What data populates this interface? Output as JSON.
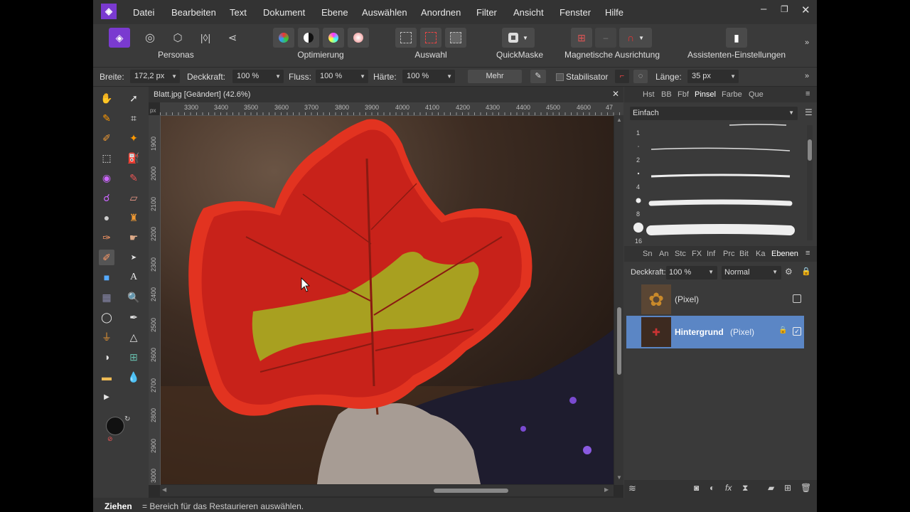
{
  "menu": [
    "Datei",
    "Bearbeiten",
    "Text",
    "Dokument",
    "Ebene",
    "Auswählen",
    "Anordnen",
    "Filter",
    "Ansicht",
    "Fenster",
    "Hilfe"
  ],
  "toolbar": {
    "personas_label": "Personas",
    "optimierung_label": "Optimierung",
    "auswahl_label": "Auswahl",
    "quickmaske_label": "QuickMaske",
    "magnetisch_label": "Magnetische Ausrichtung",
    "assistent_label": "Assistenten-Einstellungen"
  },
  "context": {
    "breite_label": "Breite:",
    "breite_value": "172,2 px",
    "deckkraft_label": "Deckkraft:",
    "deckkraft_value": "100 %",
    "fluss_label": "Fluss:",
    "fluss_value": "100 %",
    "haerte_label": "Härte:",
    "haerte_value": "100 %",
    "mehr_label": "Mehr",
    "stabilisator_label": "Stabilisator",
    "laenge_label": "Länge:",
    "laenge_value": "35 px"
  },
  "document": {
    "tab_title": "Blatt.jpg [Geändert] (42.6%)",
    "ruler_unit": "px",
    "ruler_h": [
      "3300",
      "3400",
      "3500",
      "3600",
      "3700",
      "3800",
      "3900",
      "4000",
      "4100",
      "4200",
      "4300",
      "4400",
      "4500",
      "4600",
      "47"
    ],
    "ruler_v": [
      "1900",
      "2000",
      "2100",
      "2200",
      "2300",
      "2400",
      "2500",
      "2600",
      "2700",
      "2800",
      "2900",
      "3000"
    ]
  },
  "brushes": {
    "tabs": [
      "Hst",
      "BB",
      "Fbf",
      "Pinsel",
      "Farbe",
      "Que"
    ],
    "active_tab": "Pinsel",
    "category": "Einfach",
    "sizes": [
      "1",
      "2",
      "4",
      "8",
      "16"
    ]
  },
  "layers": {
    "tabs": [
      "Sn",
      "An",
      "Stc",
      "FX",
      "Inf",
      "Prc",
      "Bit",
      "Ka",
      "Ebenen"
    ],
    "active_tab": "Ebenen",
    "deckkraft_label": "Deckkraft:",
    "deckkraft_value": "100 %",
    "blend_mode": "Normal",
    "items": [
      {
        "name": "(Pixel)",
        "bold": ""
      },
      {
        "name": "(Pixel)",
        "bold": "Hintergrund"
      }
    ]
  },
  "status": {
    "bold": "Ziehen",
    "text": "= Bereich für das Restaurieren auswählen."
  },
  "colors": {
    "accent": "#5b86c5",
    "leaf_red": "#d42418",
    "leaf_yellow": "#a8a020",
    "app_bg": "#3a3a3a"
  }
}
